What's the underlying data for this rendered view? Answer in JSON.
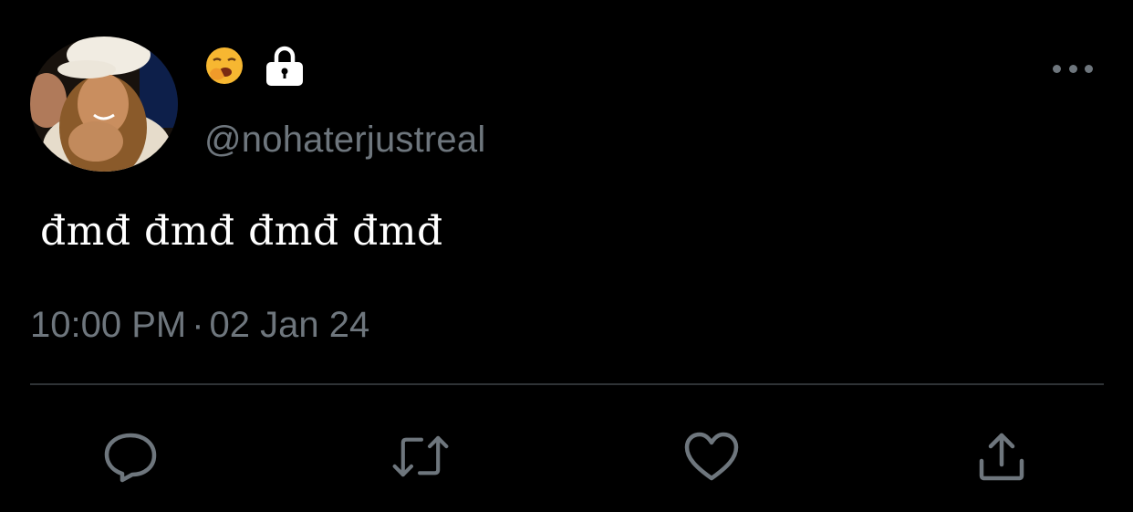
{
  "user": {
    "avatar_icon": "profile-photo",
    "name_emoji_icon": "yawning-face-emoji",
    "name_badge_icon": "lock-icon",
    "handle": "@nohaterjustreal"
  },
  "tweet": {
    "text": "đmđ đmđ đmđ đmđ",
    "time": "10:00 PM",
    "separator": "·",
    "date": "02 Jan 24"
  },
  "menu": {
    "more_icon": "more-options-icon"
  },
  "actions": [
    {
      "icon": "reply-icon"
    },
    {
      "icon": "retweet-icon"
    },
    {
      "icon": "like-icon"
    },
    {
      "icon": "share-icon"
    }
  ],
  "colors": {
    "background": "#000000",
    "primary_text": "#ffffff",
    "secondary_text": "#6e767d",
    "divider": "#2f3336"
  }
}
